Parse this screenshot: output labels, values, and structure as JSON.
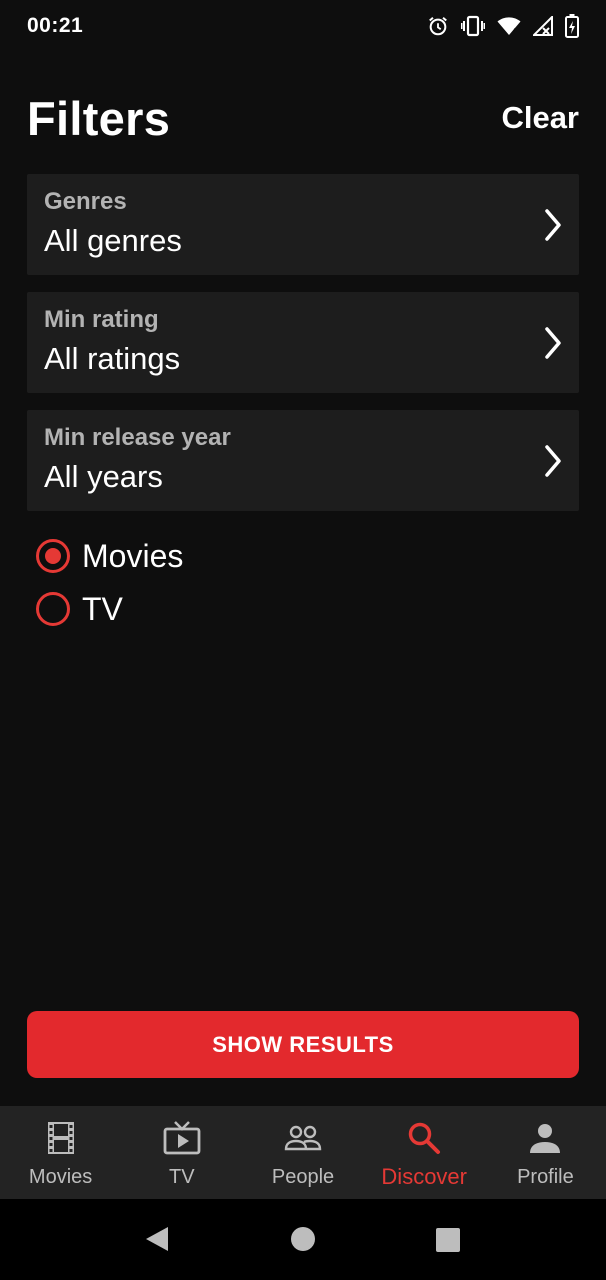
{
  "status_bar": {
    "time": "00:21",
    "icons": [
      "alarm-icon",
      "vibrate-icon",
      "wifi-icon",
      "signal-icon",
      "battery-icon"
    ]
  },
  "header": {
    "title": "Filters",
    "clear_label": "Clear"
  },
  "filters": [
    {
      "label": "Genres",
      "value": "All genres",
      "icon": "chevron-right-icon"
    },
    {
      "label": "Min rating",
      "value": "All ratings",
      "icon": "chevron-right-icon"
    },
    {
      "label": "Min release year",
      "value": "All years",
      "icon": "chevron-right-icon"
    }
  ],
  "media_type": {
    "options": [
      {
        "label": "Movies",
        "checked": true
      },
      {
        "label": "TV",
        "checked": false
      }
    ]
  },
  "show_results_label": "SHOW RESULTS",
  "tabs": [
    {
      "label": "Movies",
      "icon": "film-icon",
      "active": false
    },
    {
      "label": "TV",
      "icon": "tv-icon",
      "active": false
    },
    {
      "label": "People",
      "icon": "people-icon",
      "active": false
    },
    {
      "label": "Discover",
      "icon": "search-icon",
      "active": true
    },
    {
      "label": "Profile",
      "icon": "person-icon",
      "active": false
    }
  ],
  "system_nav": [
    "back-icon",
    "home-icon",
    "recents-icon"
  ],
  "colors": {
    "background": "#0e0e0e",
    "card": "#1d1d1d",
    "accent": "#e53935",
    "button": "#e3292d",
    "tab_bar": "#232323"
  }
}
